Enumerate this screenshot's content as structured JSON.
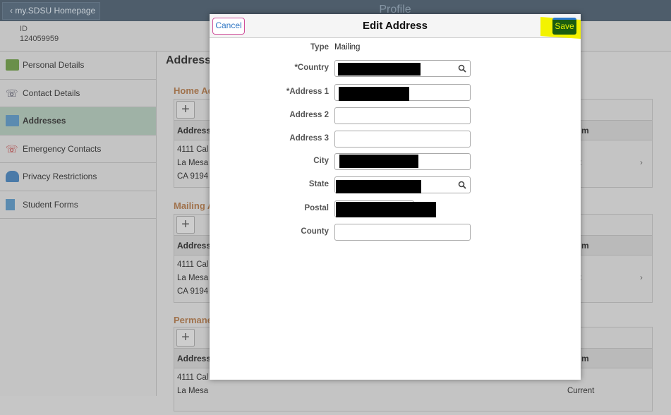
{
  "header": {
    "back_label": "my.SDSU Homepage",
    "title": "Profile"
  },
  "id_block": {
    "label": "ID",
    "value": "124059959"
  },
  "sidebar": {
    "items": [
      {
        "label": "Personal Details",
        "icon": "id-card-icon"
      },
      {
        "label": "Contact Details",
        "icon": "phone-at-icon"
      },
      {
        "label": "Addresses",
        "icon": "envelope-icon",
        "active": true
      },
      {
        "label": "Emergency Contacts",
        "icon": "phone-plus-icon"
      },
      {
        "label": "Privacy Restrictions",
        "icon": "user-lock-icon"
      },
      {
        "label": "Student Forms",
        "icon": "document-icon"
      }
    ]
  },
  "main": {
    "heading": "Address",
    "sections": [
      {
        "title": "Home Ad",
        "col1": "Address",
        "col2": "m",
        "lines": [
          "4111 Cal",
          "La Mesa",
          "CA 9194"
        ],
        "status": "rent"
      },
      {
        "title": "Mailing A",
        "col1": "Address",
        "col2": "m",
        "lines": [
          "4111 Cal",
          "La Mesa",
          "CA 9194"
        ],
        "status": "rent"
      },
      {
        "title": "Permane",
        "col1": "Address",
        "col2": "m",
        "lines": [
          "4111 Cal",
          "La Mesa"
        ],
        "status": "Current"
      }
    ]
  },
  "modal": {
    "title": "Edit Address",
    "cancel_label": "Cancel",
    "save_label": "Save",
    "highlight_color": "#f3f300",
    "fields": {
      "type": {
        "label": "Type",
        "value": "Mailing"
      },
      "country": {
        "label": "*Country"
      },
      "address1": {
        "label": "*Address 1"
      },
      "address2": {
        "label": "Address 2"
      },
      "address3": {
        "label": "Address 3"
      },
      "city": {
        "label": "City"
      },
      "state": {
        "label": "State"
      },
      "postal": {
        "label": "Postal"
      },
      "county": {
        "label": "County"
      }
    }
  }
}
